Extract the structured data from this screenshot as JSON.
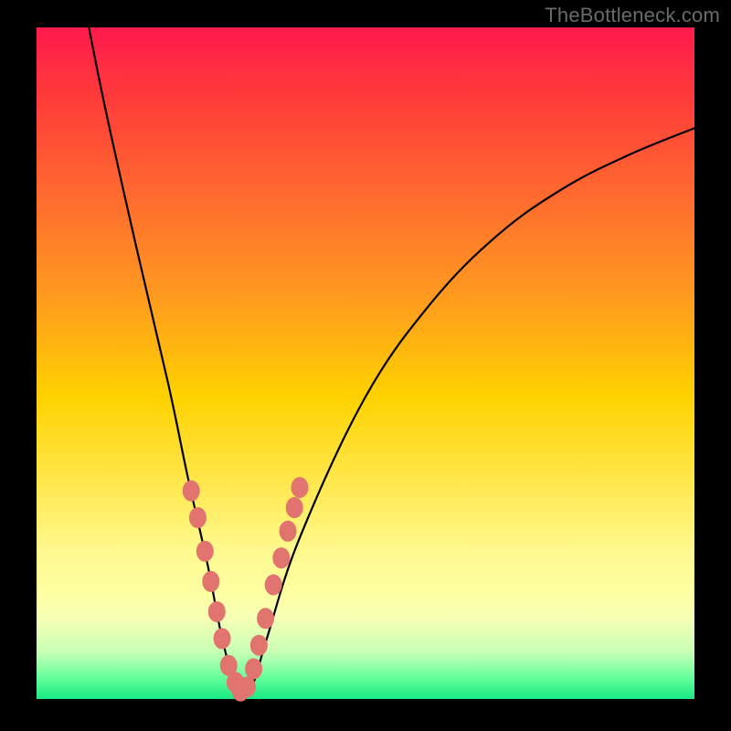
{
  "watermark": "TheBottleneck.com",
  "chart_data": {
    "type": "line",
    "title": "",
    "xlabel": "",
    "ylabel": "",
    "xlim": [
      0,
      100
    ],
    "ylim": [
      0,
      100
    ],
    "series": [
      {
        "name": "bottleneck-curve",
        "x": [
          6,
          10,
          15,
          20,
          23,
          26,
          28,
          30,
          31.5,
          33,
          35,
          40,
          50,
          60,
          70,
          80,
          90,
          100
        ],
        "y": [
          110,
          90,
          68,
          47,
          33,
          20,
          10,
          2.5,
          1,
          2.5,
          9,
          24,
          45,
          59,
          69,
          76,
          81,
          85
        ]
      }
    ],
    "markers": {
      "x": [
        23.5,
        24.5,
        25.6,
        26.5,
        27.4,
        28.2,
        29.2,
        30.2,
        31.0,
        32.0,
        33.0,
        33.8,
        34.8,
        36.0,
        37.2,
        38.2,
        39.2,
        40.0
      ],
      "y": [
        31.0,
        27.0,
        22.0,
        17.5,
        13.0,
        9.0,
        5.0,
        2.5,
        1.2,
        1.8,
        4.5,
        8.0,
        12.0,
        17.0,
        21.0,
        25.0,
        28.5,
        31.5
      ]
    },
    "colors": {
      "curve": "#000000",
      "markers": "#e2746f",
      "gradient_top": "#ff1a4d",
      "gradient_bottom": "#18e982"
    }
  }
}
